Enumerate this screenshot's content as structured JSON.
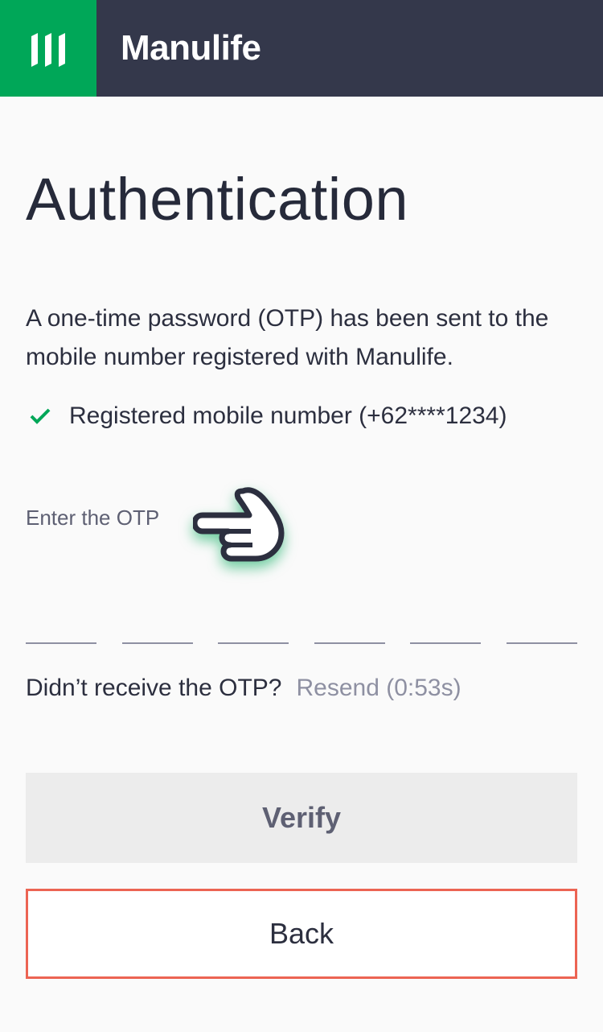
{
  "header": {
    "brand": "Manulife",
    "logo_icon": "manulife-m-logo-icon",
    "colors": {
      "header_bg": "#34384b",
      "logo_bg": "#00a758"
    }
  },
  "page": {
    "title": "Authentication",
    "description": "A one-time password (OTP)  has been sent to the mobile number registered with Manulife.",
    "registered_mobile": "Registered mobile number (+62****1234)",
    "otp_label": "Enter the OTP",
    "otp_digits": [
      "",
      "",
      "",
      "",
      "",
      ""
    ],
    "resend_question": "Didn’t receive the OTP?",
    "resend_link": "Resend (0:53s)"
  },
  "actions": {
    "verify_label": "Verify",
    "back_label": "Back",
    "colors": {
      "back_border": "#ec6453",
      "check": "#00a758"
    }
  }
}
